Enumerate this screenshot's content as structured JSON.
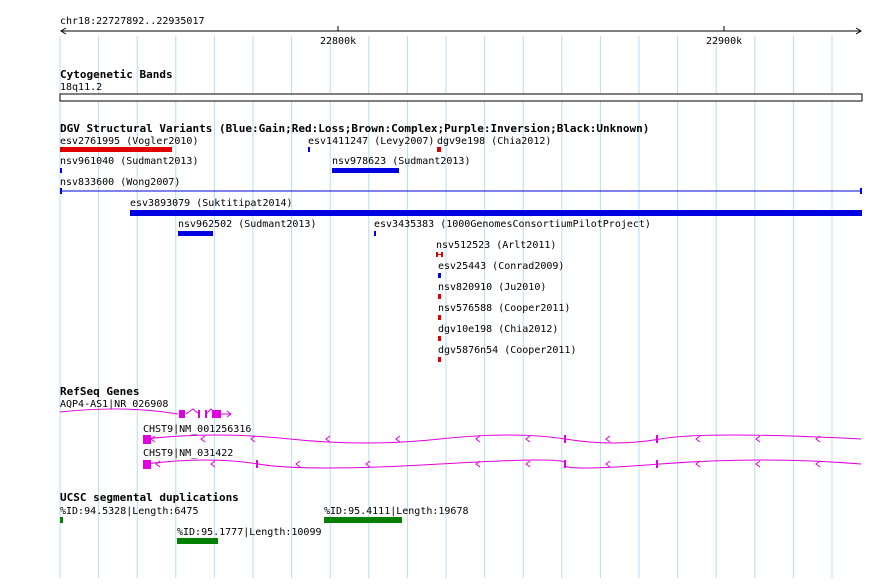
{
  "ruler": {
    "position_label": "chr18:22727892..22935017",
    "ticks": [
      {
        "label": "22800k",
        "pos": 22800000
      },
      {
        "label": "22900k",
        "pos": 22900000
      }
    ]
  },
  "tracks": {
    "cytoband": {
      "title": "Cytogenetic Bands",
      "band_label": "18q11.2"
    },
    "dgv": {
      "title": "DGV Structural Variants (Blue:Gain;Red:Loss;Brown:Complex;Purple:Inversion;Black:Unknown)",
      "features": [
        {
          "label": "esv2761995 (Vogler2010)",
          "color": "#e00000"
        },
        {
          "label": "esv1411247 (Levy2007)",
          "color": "#0000e0"
        },
        {
          "label": "dgv9e198 (Chia2012)",
          "color": "#e00000"
        },
        {
          "label": "nsv961040 (Sudmant2013)",
          "color": "#0000e0"
        },
        {
          "label": "nsv978623 (Sudmant2013)",
          "color": "#0000e0"
        },
        {
          "label": "nsv833600 (Wong2007)",
          "color": "#0000e0"
        },
        {
          "label": "esv3893079 (Suktitipat2014)",
          "color": "#0000e0"
        },
        {
          "label": "nsv962502 (Sudmant2013)",
          "color": "#0000e0"
        },
        {
          "label": "esv3435383 (1000GenomesConsortiumPilotProject)",
          "color": "#0000e0"
        },
        {
          "label": "nsv512523 (Arlt2011)",
          "color": "#e00000"
        },
        {
          "label": "esv25443 (Conrad2009)",
          "color": "#0000e0"
        },
        {
          "label": "nsv820910 (Ju2010)",
          "color": "#e00000"
        },
        {
          "label": "nsv576588 (Cooper2011)",
          "color": "#e00000"
        },
        {
          "label": "dgv10e198 (Chia2012)",
          "color": "#e00000"
        },
        {
          "label": "dgv5876n54 (Cooper2011)",
          "color": "#e00000"
        }
      ]
    },
    "refseq": {
      "title": "RefSeq Genes",
      "color": "#e000e0",
      "genes": [
        {
          "label": "AQP4-AS1|NR_026908"
        },
        {
          "label": "CHST9|NM_001256316"
        },
        {
          "label": "CHST9|NM_031422"
        }
      ]
    },
    "segdups": {
      "title": "UCSC segmental duplications",
      "color": "#008000",
      "features": [
        {
          "label": "%ID:94.5328|Length:6475"
        },
        {
          "label": "%ID:95.4111|Length:19678"
        },
        {
          "label": "%ID:95.1777|Length:10099"
        }
      ]
    }
  }
}
